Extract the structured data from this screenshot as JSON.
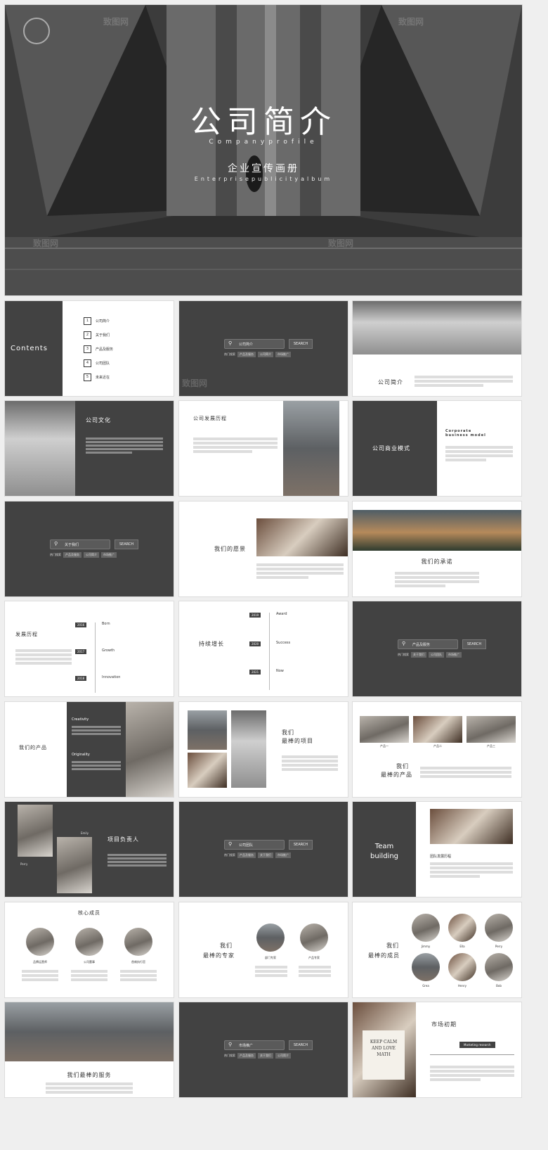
{
  "hero": {
    "title": "公司简介",
    "title_en": "Companyprofile",
    "subtitle": "企业宣传画册",
    "subtitle_en": "Enterprisepublicityalbum",
    "watermark": "致图网"
  },
  "contents": {
    "title": "Contents",
    "items": [
      {
        "num": "1",
        "label": "公司简介"
      },
      {
        "num": "2",
        "label": "关于我们"
      },
      {
        "num": "3",
        "label": "产品及服务"
      },
      {
        "num": "4",
        "label": "公司团队"
      },
      {
        "num": "5",
        "label": "未来近在"
      }
    ]
  },
  "search_slides": [
    {
      "query": "公司简介",
      "button": "SEARCH",
      "hot_label": "热门搜索",
      "chips": [
        "产品及服务",
        "公司简介",
        "市场推广"
      ]
    },
    {
      "query": "关于我们",
      "button": "SEARCH",
      "hot_label": "热门搜索",
      "chips": [
        "产品及服务",
        "公司简介",
        "市场推广"
      ]
    },
    {
      "query": "产品及服务",
      "button": "SEARCH",
      "hot_label": "热门搜索",
      "chips": [
        "关于我们",
        "公司团队",
        "市场推广"
      ]
    },
    {
      "query": "公司团队",
      "button": "SEARCH",
      "hot_label": "热门搜索",
      "chips": [
        "产品及服务",
        "关于我们",
        "市场推广"
      ]
    },
    {
      "query": "市场推广",
      "button": "SEARCH",
      "hot_label": "热门搜索",
      "chips": [
        "产品及服务",
        "关于我们",
        "公司简介"
      ]
    }
  ],
  "slides": {
    "intro": {
      "title": "公司简介"
    },
    "culture": {
      "title": "公司文化"
    },
    "history": {
      "title": "公司发展历程"
    },
    "business": {
      "title": "公司商业模式",
      "side_title": "Corporate business model"
    },
    "vision": {
      "title": "我们的愿景"
    },
    "commitment": {
      "title": "我们的承诺"
    },
    "timeline": {
      "title": "发展历程",
      "rows": [
        {
          "year": "2016",
          "label": "Born"
        },
        {
          "year": "2017",
          "label": "Growth"
        },
        {
          "year": "2018",
          "label": "Innovation"
        }
      ]
    },
    "growth": {
      "title": "持续增长",
      "rows": [
        {
          "year": "2019",
          "label": "Award"
        },
        {
          "year": "2020",
          "label": "Success"
        },
        {
          "year": "2021",
          "label": "Now"
        }
      ]
    },
    "products": {
      "title": "我们的产品",
      "tags": [
        "Creativity",
        "Originality"
      ]
    },
    "projects": {
      "title_a": "我们",
      "title_b": "最棒的项目"
    },
    "best_products": {
      "title_a": "我们",
      "title_b": "最棒的产品",
      "captions": [
        "产品一",
        "产品二",
        "产品三"
      ]
    },
    "leader": {
      "title": "项目负责人",
      "names": [
        "Perry",
        "Emily"
      ]
    },
    "team": {
      "title_a": "Team",
      "title_b": "building",
      "caption": "团队发展历程"
    },
    "core": {
      "title": "核心成员",
      "roles": [
        "品牌运营师",
        "公司董事",
        "首席执行官"
      ]
    },
    "experts": {
      "title_a": "我们",
      "title_b": "最棒的专家",
      "roles": [
        "部门专家",
        "产品专家"
      ]
    },
    "members": {
      "title_a": "我们",
      "title_b": "最棒的成员",
      "names": [
        "Jimmy",
        "Ella",
        "Perry",
        "Grea",
        "Henry",
        "Bob"
      ]
    },
    "service": {
      "title": "我们最棒的服务"
    },
    "market": {
      "title": "市场初期",
      "tag": "Marketing research",
      "poster": "KEEP CALM AND LOVE MATH"
    }
  }
}
